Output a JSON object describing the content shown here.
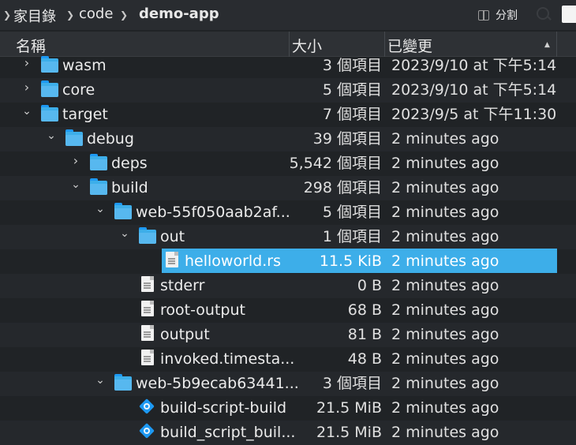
{
  "breadcrumb": {
    "home": "家目錄",
    "code": "code",
    "current": "demo-app"
  },
  "toolbar": {
    "split_label": "分割"
  },
  "columns": {
    "name": "名稱",
    "size": "大小",
    "modified": "已變更"
  },
  "rows": [
    {
      "name": "wasm",
      "size": "3 個項目",
      "modified": "2023/9/10 at 下午5:14",
      "type": "folder",
      "expanded": false
    },
    {
      "name": "core",
      "size": "5 個項目",
      "modified": "2023/9/10 at 下午5:14",
      "type": "folder",
      "expanded": false
    },
    {
      "name": "target",
      "size": "7 個項目",
      "modified": "2023/9/5 at 下午11:30",
      "type": "folder",
      "expanded": true
    },
    {
      "name": "debug",
      "size": "39 個項目",
      "modified": "2 minutes ago",
      "type": "folder",
      "expanded": true
    },
    {
      "name": "deps",
      "size": "5,542 個項目",
      "modified": "2 minutes ago",
      "type": "folder",
      "expanded": false
    },
    {
      "name": "build",
      "size": "298 個項目",
      "modified": "2 minutes ago",
      "type": "folder",
      "expanded": true
    },
    {
      "name": "web-55f050aab2af...",
      "size": "5 個項目",
      "modified": "2 minutes ago",
      "type": "folder",
      "expanded": true
    },
    {
      "name": "out",
      "size": "1 個項目",
      "modified": "2 minutes ago",
      "type": "folder",
      "expanded": true
    },
    {
      "name": "helloworld.rs",
      "size": "11.5 KiB",
      "modified": "2 minutes ago",
      "type": "file",
      "selected": true
    },
    {
      "name": "stderr",
      "size": "0 B",
      "modified": "2 minutes ago",
      "type": "file"
    },
    {
      "name": "root-output",
      "size": "68 B",
      "modified": "2 minutes ago",
      "type": "file"
    },
    {
      "name": "output",
      "size": "81 B",
      "modified": "2 minutes ago",
      "type": "file"
    },
    {
      "name": "invoked.timesta...",
      "size": "48 B",
      "modified": "2 minutes ago",
      "type": "file"
    },
    {
      "name": "web-5b9ecab63441...",
      "size": "3 個項目",
      "modified": "2 minutes ago",
      "type": "folder",
      "expanded": true
    },
    {
      "name": "build-script-build",
      "size": "21.5 MiB",
      "modified": "2 minutes ago",
      "type": "executable"
    },
    {
      "name": "build_script_buil...",
      "size": "21.5 MiB",
      "modified": "2 minutes ago",
      "type": "executable"
    }
  ],
  "colors": {
    "selection": "#3daee9",
    "background": "#202326",
    "folder": "#3daee9"
  }
}
